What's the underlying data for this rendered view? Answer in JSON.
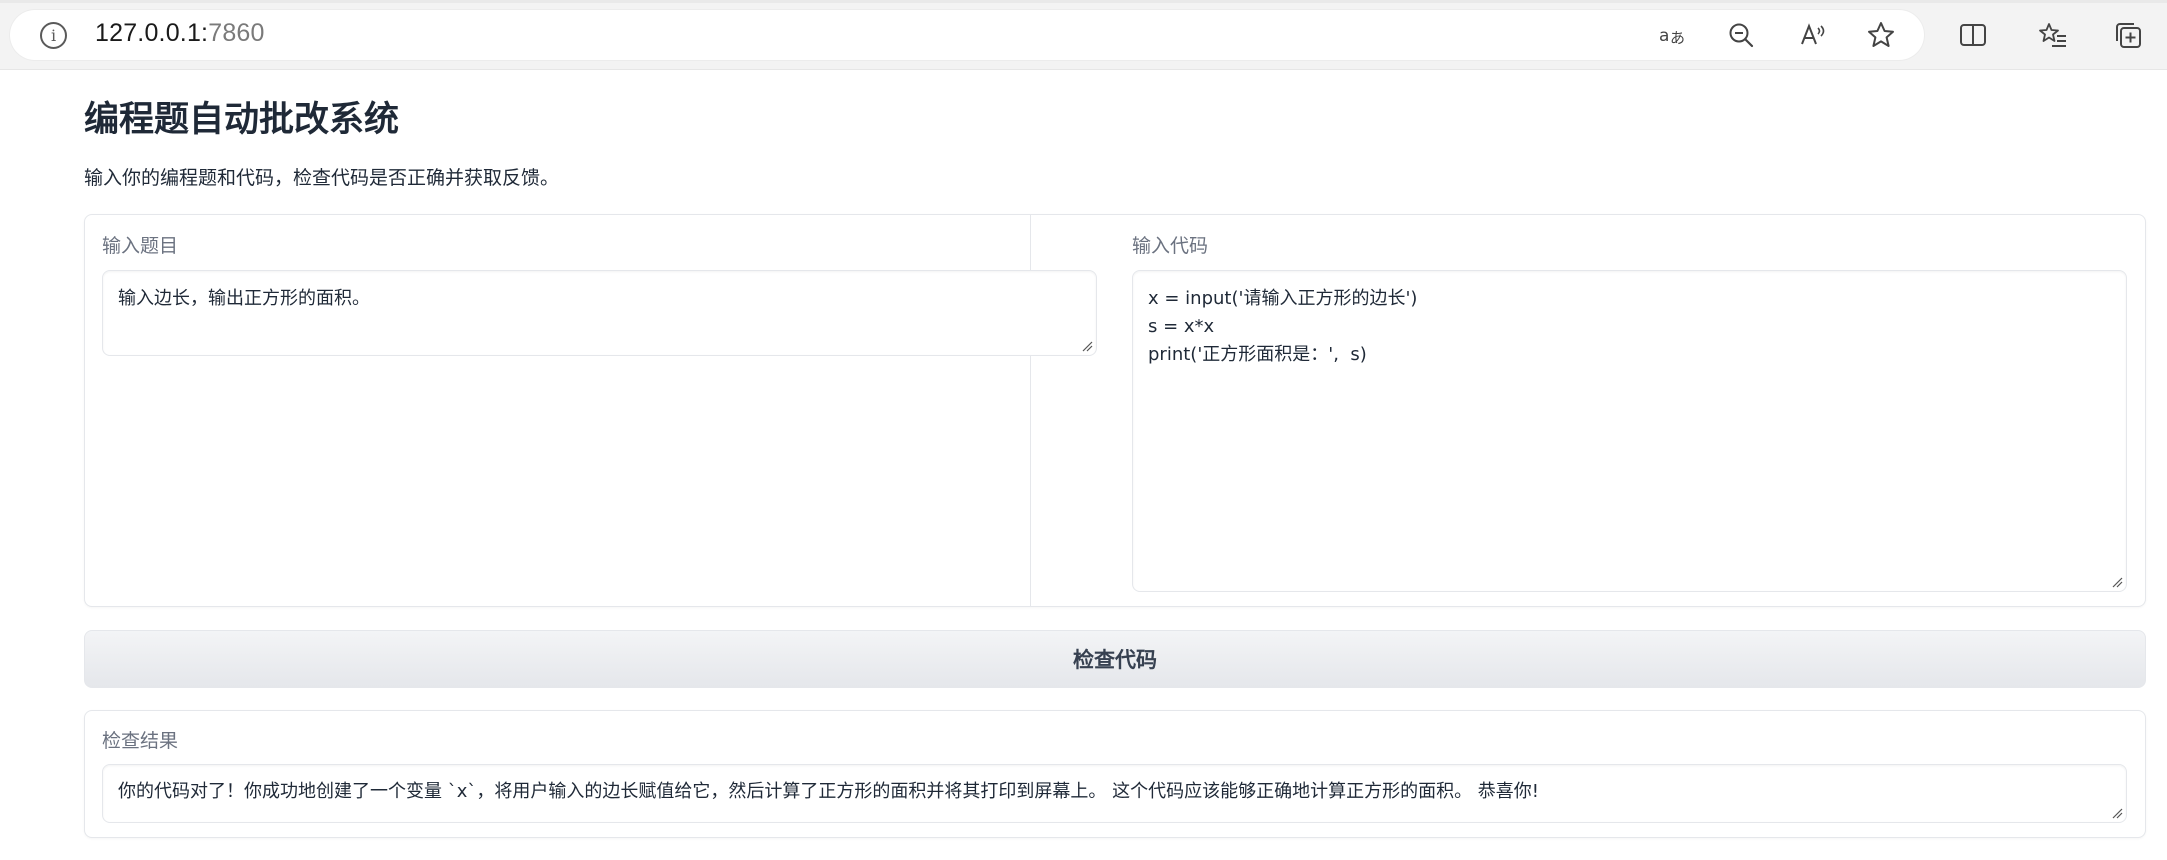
{
  "browser": {
    "url_host": "127.0.0.1:",
    "url_port": "7860",
    "toolbar_icons": [
      "read-aloud-translate-icon",
      "zoom-out-icon",
      "read-aloud-icon",
      "favorite-star-icon",
      "split-screen-icon",
      "favorites-icon",
      "collections-icon"
    ]
  },
  "page": {
    "title": "编程题自动批改系统",
    "description": "输入你的编程题和代码，检查代码是否正确并获取反馈。"
  },
  "question": {
    "label": "输入题目",
    "value": "输入边长，输出正方形的面积。"
  },
  "code": {
    "label": "输入代码",
    "lines": [
      "x = input('请输入正方形的边长')",
      "s = x*x",
      "print('正方形面积是：',  s)"
    ]
  },
  "check_button": {
    "label": "检查代码"
  },
  "result": {
    "label": "检查结果",
    "value": "你的代码对了！你成功地创建了一个变量 `x`，将用户输入的边长赋值给它，然后计算了正方形的面积并将其打印到屏幕上。 这个代码应该能够正确地计算正方形的面积。 恭喜你!"
  }
}
